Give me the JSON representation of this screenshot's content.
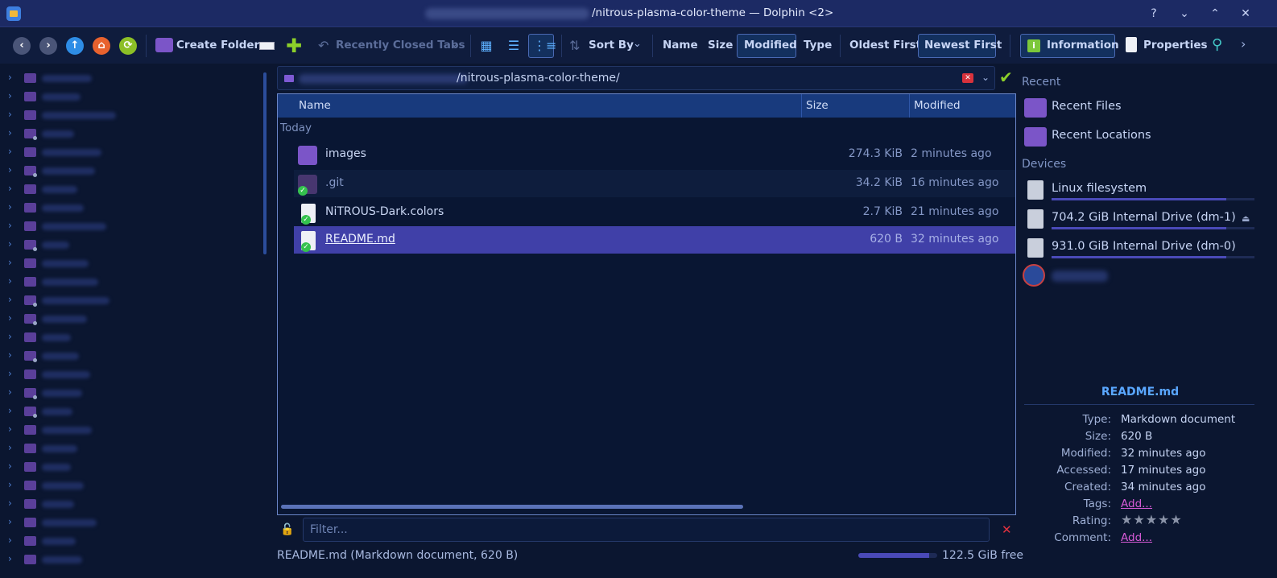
{
  "window": {
    "title": "/nitrous-plasma-color-theme — Dolphin <2>",
    "help_label": "?",
    "minimize_label": "⌄",
    "maximize_label": "⌃",
    "close_label": "✕"
  },
  "toolbar": {
    "create_folder": "Create Folder",
    "recently_closed_tabs": "Recently Closed Tabs",
    "sort_by": "Sort By",
    "sort_name": "Name",
    "sort_size": "Size",
    "sort_modified": "Modified",
    "sort_type": "Type",
    "oldest_first": "Oldest First",
    "newest_first": "Newest First",
    "information": "Information",
    "properties": "Properties"
  },
  "location": {
    "path": "/nitrous-plasma-color-theme/"
  },
  "file_view": {
    "columns": {
      "name": "Name",
      "size": "Size",
      "modified": "Modified"
    },
    "group": "Today",
    "files": [
      {
        "name": "images",
        "size": "274.3 KiB",
        "modified": "2 minutes ago",
        "icon": "folder-images-icon"
      },
      {
        "name": ".git",
        "size": "34.2 KiB",
        "modified": "16 minutes ago",
        "icon": "folder-git-icon"
      },
      {
        "name": "NiTROUS-Dark.colors",
        "size": "2.7 KiB",
        "modified": "21 minutes ago",
        "icon": "text-document-icon"
      },
      {
        "name": "README.md",
        "size": "620 B",
        "modified": "32 minutes ago",
        "icon": "markdown-document-icon"
      }
    ],
    "selected_index": 3
  },
  "filter": {
    "placeholder": "Filter..."
  },
  "status": {
    "text": "README.md (Markdown document, 620 B)",
    "free_space": "122.5 GiB free",
    "used_fraction": 0.9
  },
  "places": {
    "recent_header": "Recent",
    "recent_files": "Recent Files",
    "recent_locations": "Recent Locations",
    "devices_header": "Devices",
    "devices": [
      {
        "label": "Linux filesystem",
        "used_fraction": 0.86
      },
      {
        "label": "704.2 GiB Internal Drive (dm-1)",
        "used_fraction": 0.86
      },
      {
        "label": "931.0 GiB Internal Drive (dm-0)",
        "used_fraction": 0.86
      }
    ]
  },
  "information": {
    "title": "README.md",
    "type_key": "Type:",
    "type_val": "Markdown document",
    "size_key": "Size:",
    "size_val": "620 B",
    "modified_key": "Modified:",
    "modified_val": "32 minutes ago",
    "accessed_key": "Accessed:",
    "accessed_val": "17 minutes ago",
    "created_key": "Created:",
    "created_val": "34 minutes ago",
    "tags_key": "Tags:",
    "tags_val": "Add...",
    "rating_key": "Rating:",
    "rating_val": "★★★★★",
    "comment_key": "Comment:",
    "comment_val": "Add..."
  },
  "colors": {
    "accent": "#5aa7ff",
    "selection": "#4040a8",
    "titlebar": "#1c2a64",
    "background": "#0b1630"
  }
}
